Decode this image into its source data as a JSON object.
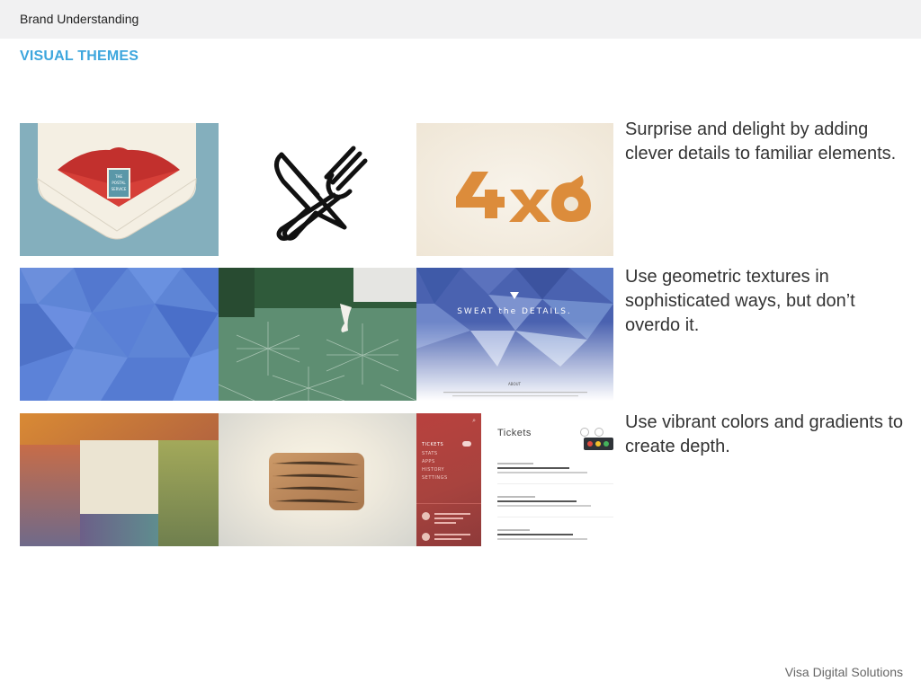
{
  "header": {
    "title": "Brand Understanding"
  },
  "section": {
    "title": "VISUAL THEMES"
  },
  "themes": [
    {
      "text": "Surprise and delight by adding clever details to familiar elements."
    },
    {
      "text": "Use geometric textures in sophisticated ways, but don’t overdo it."
    },
    {
      "text": "Use vibrant colors and gradients to create depth."
    }
  ],
  "tiles": {
    "postal": {
      "line1": "THE",
      "line2": "POSTAL",
      "line3": "SERVICE"
    },
    "sweat": {
      "heading": "SWEAT the DETAILS.",
      "about": "ABOUT"
    },
    "redapp": {
      "nav": [
        "TICKETS",
        "STATS",
        "APPS",
        "HISTORY",
        "SETTINGS"
      ]
    },
    "tickets": {
      "title": "Tickets"
    }
  },
  "footer": {
    "brand": "Visa Digital Solutions"
  },
  "colors": {
    "accent": "#3da6dd",
    "topbar": "#f1f1f2"
  }
}
